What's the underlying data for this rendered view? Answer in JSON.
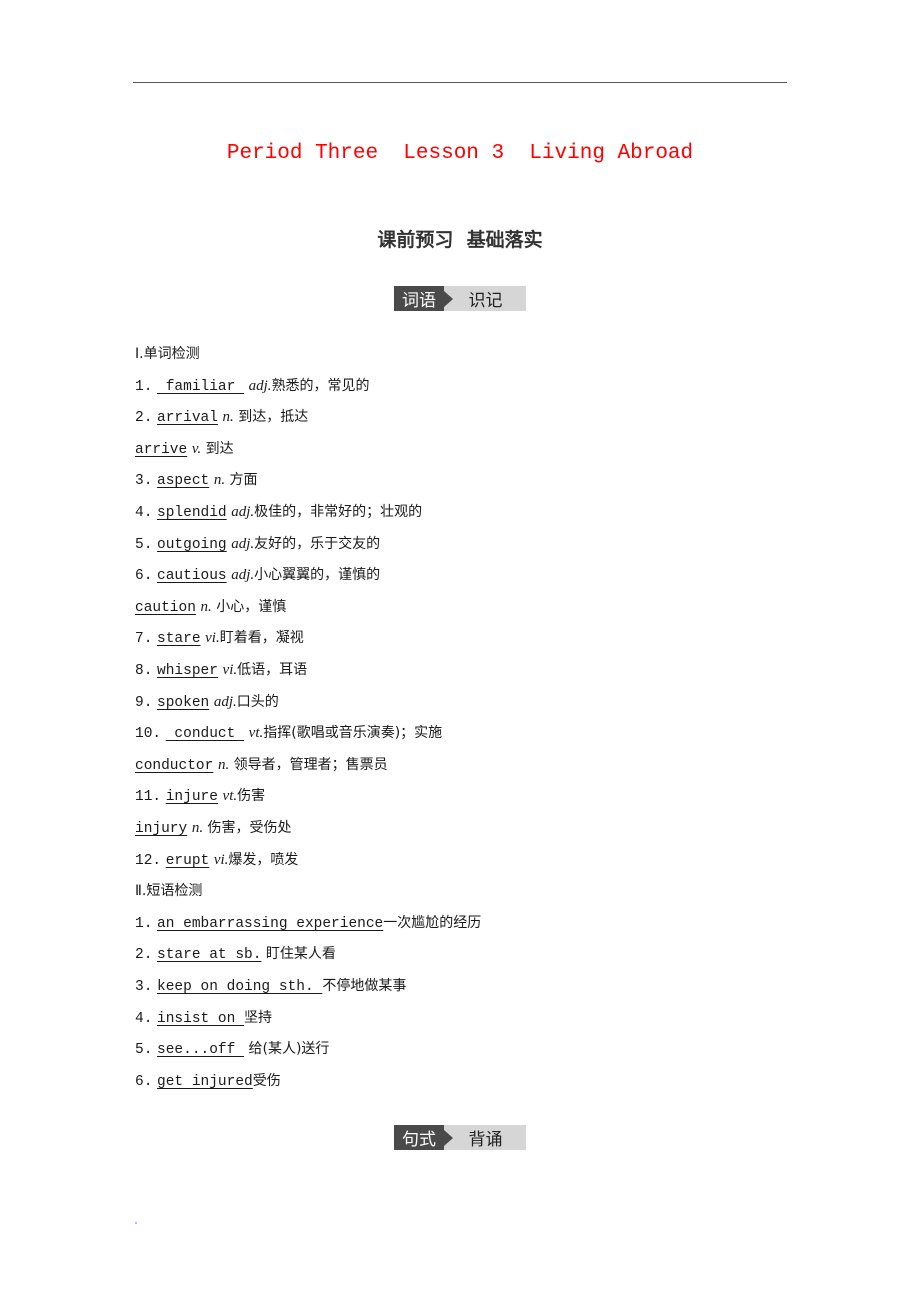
{
  "header": {
    "title": "Period Three  Lesson 3  Living Abroad",
    "subtitle": "课前预习  基础落实"
  },
  "badges": [
    {
      "dark": "词语",
      "light": "识记"
    },
    {
      "dark": "句式",
      "light": "背诵"
    }
  ],
  "section1": {
    "heading": "Ⅰ.单词检测",
    "items": [
      {
        "num": "1.",
        "word": " familiar ",
        "pos": "adj.",
        "meaning": "熟悉的，常见的"
      },
      {
        "num": "2.",
        "word": "arrival",
        "pos": "n.",
        "meaning": " 到达，抵达"
      },
      {
        "num": "",
        "word": "arrive",
        "pos": "v.",
        "meaning": " 到达"
      },
      {
        "num": "3.",
        "word": "aspect",
        "pos": "n.",
        "meaning": " 方面"
      },
      {
        "num": "4.",
        "word": "splendid",
        "pos": "adj.",
        "meaning": "极佳的，非常好的；壮观的"
      },
      {
        "num": "5.",
        "word": "outgoing",
        "pos": "adj.",
        "meaning": "友好的，乐于交友的"
      },
      {
        "num": "6.",
        "word": "cautious",
        "pos": "adj.",
        "meaning": "小心翼翼的，谨慎的"
      },
      {
        "num": "",
        "word": "caution",
        "pos": "n.",
        "meaning": " 小心，谨慎"
      },
      {
        "num": "7.",
        "word": "stare",
        "pos": "vi.",
        "meaning": "盯着看，凝视"
      },
      {
        "num": "8.",
        "word": "whisper",
        "pos": "vi.",
        "meaning": "低语，耳语"
      },
      {
        "num": "9.",
        "word": "spoken",
        "pos": "adj.",
        "meaning": "口头的"
      },
      {
        "num": "10.",
        "word": " conduct ",
        "pos": "vt.",
        "meaning": "指挥(歌唱或音乐演奏)；实施"
      },
      {
        "num": "",
        "word": "conductor",
        "pos": "n.",
        "meaning": " 领导者，管理者；售票员"
      },
      {
        "num": "11.",
        "word": "injure",
        "pos": "vt.",
        "meaning": "伤害"
      },
      {
        "num": "",
        "word": "injury",
        "pos": "n.",
        "meaning": " 伤害，受伤处"
      },
      {
        "num": "12.",
        "word": "erupt",
        "pos": "vi.",
        "meaning": "爆发，喷发"
      }
    ]
  },
  "section2": {
    "heading": "Ⅱ.短语检测",
    "items": [
      {
        "num": "1.",
        "phrase": "an embarrassing experience",
        "meaning": "一次尴尬的经历"
      },
      {
        "num": "2.",
        "phrase": "stare at sb.",
        "meaning": " 盯住某人看"
      },
      {
        "num": "3.",
        "phrase": "keep on doing sth. ",
        "meaning": "不停地做某事"
      },
      {
        "num": "4.",
        "phrase": "insist on ",
        "meaning": "坚持"
      },
      {
        "num": "5.",
        "phrase": "see...off ",
        "meaning": " 给(某人)送行"
      },
      {
        "num": "6.",
        "phrase": "get injured",
        "meaning": "受伤"
      }
    ]
  }
}
